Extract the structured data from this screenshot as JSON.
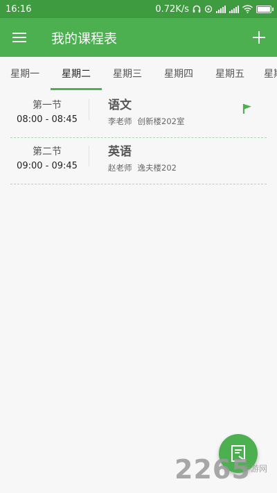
{
  "status_bar": {
    "time": "16:16",
    "network_speed": "0.72K/s",
    "icons": [
      "headphones-icon",
      "sync-icon",
      "signal-icon",
      "signal-icon",
      "wifi-icon",
      "battery-icon"
    ]
  },
  "app_bar": {
    "title": "我的课程表",
    "menu_icon": "hamburger-menu-icon",
    "add_icon": "plus-icon"
  },
  "tabs": [
    {
      "label": "星期一",
      "active": false
    },
    {
      "label": "星期二",
      "active": true
    },
    {
      "label": "星期三",
      "active": false
    },
    {
      "label": "星期四",
      "active": false
    },
    {
      "label": "星期五",
      "active": false
    },
    {
      "label": "星期六",
      "active": false
    }
  ],
  "courses": [
    {
      "period": "第一节",
      "time": "08:00 - 08:45",
      "subject": "语文",
      "teacher": "李老师",
      "location": "创新楼202室",
      "flagged": true
    },
    {
      "period": "第二节",
      "time": "09:00 - 09:45",
      "subject": "英语",
      "teacher": "赵老师",
      "location": "逸夫楼202",
      "flagged": false
    }
  ],
  "fab": {
    "icon": "notes-icon"
  },
  "watermark": {
    "number": "2265",
    "site": "手游网"
  },
  "colors": {
    "primary": "#4caf50",
    "status_bar": "#3e9b40",
    "background": "#f7f7f7",
    "divider": "#a8d8aa"
  }
}
